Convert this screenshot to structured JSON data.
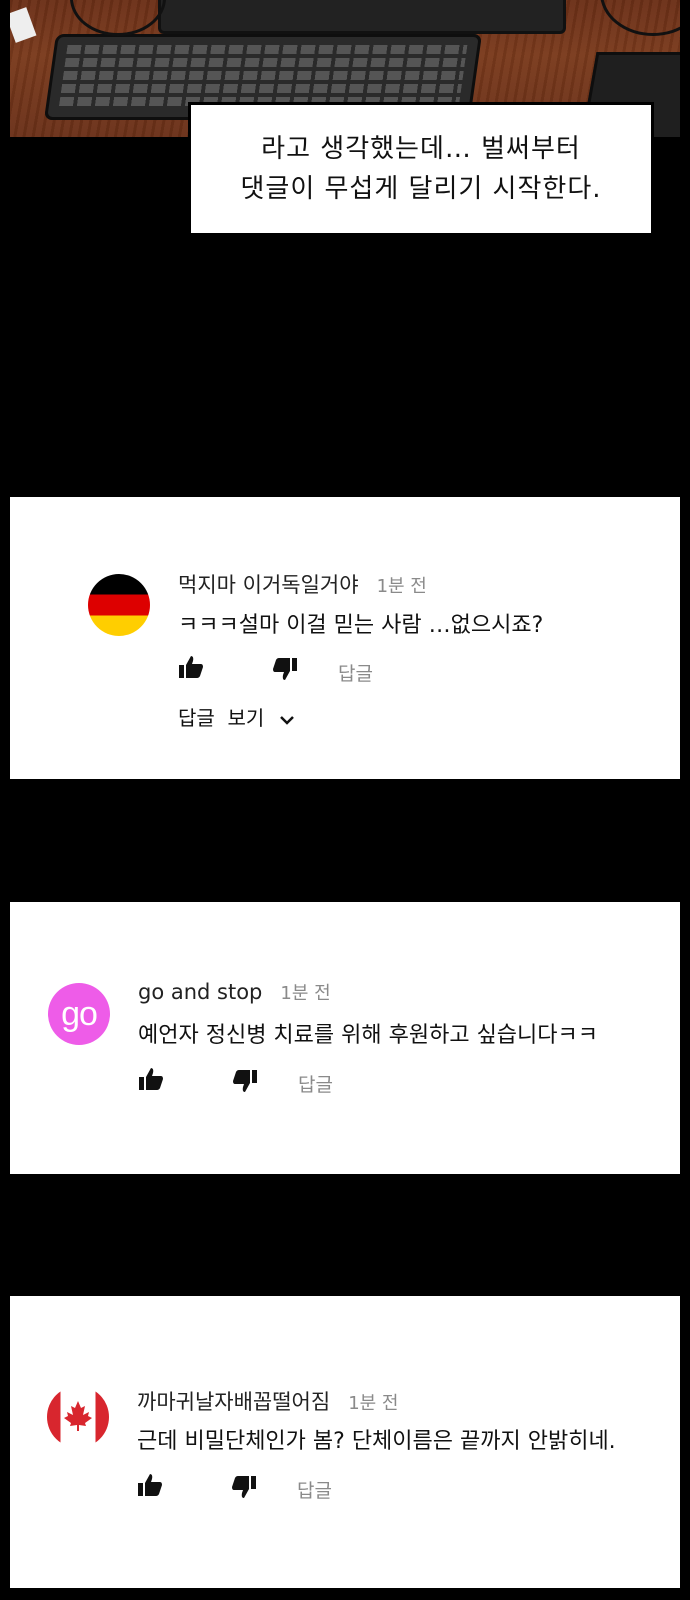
{
  "scene": {
    "caption_line1": "라고 생각했는데… 벌써부터",
    "caption_line2": "댓글이 무섭게 달리기 시작한다."
  },
  "comments": [
    {
      "author": "먹지마 이거독일거야",
      "time": "1분 전",
      "text": "ㅋㅋㅋ설마 이걸 믿는 사람 …없으시죠?",
      "reply_label": "답글",
      "view_replies": "답글  보기",
      "avatar_icon": "germany-flag-icon"
    },
    {
      "author": "go and stop",
      "time": "1분 전",
      "text": "예언자 정신병 치료를 위해 후원하고 싶습니다ㅋㅋ",
      "reply_label": "답글",
      "avatar_text": "go"
    },
    {
      "author": "까마귀날자배꼽떨어짐",
      "time": "1분 전",
      "text": "근데 비밀단체인가 봄? 단체이름은 끝까지 안밝히네.",
      "reply_label": "답글",
      "avatar_icon": "canada-flag-icon"
    }
  ],
  "colors": {
    "background": "#000000",
    "card": "#ffffff",
    "meta_gray": "#8a8a8a",
    "go_avatar": "#ee5ce8"
  }
}
